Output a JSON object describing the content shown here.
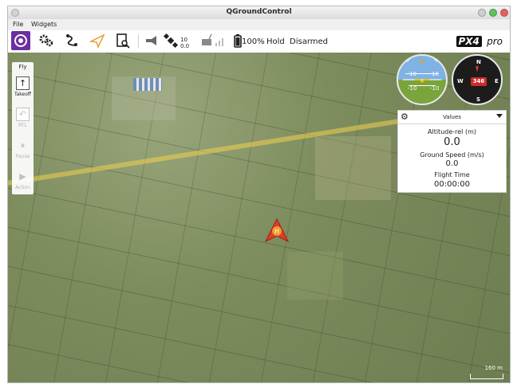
{
  "window": {
    "title": "QGroundControl"
  },
  "menu": {
    "file": "File",
    "widgets": "Widgets"
  },
  "toolbar": {
    "gps_count": "10",
    "gps_hdop": "0.0",
    "battery": "100%",
    "flight_mode": "Hold",
    "arm_state": "Disarmed",
    "logo_text": "PX4",
    "logo_pro": "pro"
  },
  "fly_panel": {
    "title": "Fly",
    "buttons": [
      {
        "label": "Takeoff",
        "enabled": true
      },
      {
        "label": "RTL",
        "enabled": false
      },
      {
        "label": "Pause",
        "enabled": false
      },
      {
        "label": "Action",
        "enabled": false
      }
    ]
  },
  "attitude": {
    "pitch_top": "10",
    "pitch_mid_left": "10",
    "pitch_mid_right": "10",
    "pitch_bot": "-10",
    "pitch_bot_right": "-10"
  },
  "compass": {
    "n": "N",
    "e": "E",
    "s": "S",
    "w": "W",
    "heading": "346"
  },
  "values": {
    "header": "Values",
    "items": [
      {
        "label": "Altitude-rel (m)",
        "value": "0.0"
      },
      {
        "label": "Ground Speed (m/s)",
        "value": "0.0"
      },
      {
        "label": "Flight Time",
        "value": "00:00:00"
      }
    ]
  },
  "map": {
    "scale": "160 m",
    "home_label": "H"
  },
  "colors": {
    "accent": "#6b2fa0",
    "vehicle": "#e23b2c",
    "flightline": "#f0d250"
  }
}
